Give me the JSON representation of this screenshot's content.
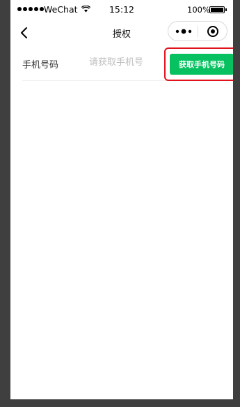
{
  "status_bar": {
    "carrier": "WeChat",
    "time": "15:12",
    "battery": "100%"
  },
  "nav": {
    "title": "授权",
    "icons": {
      "back": "chevron-left-icon",
      "more": "more-dots-icon",
      "close": "target-circle-icon"
    }
  },
  "form": {
    "label": "手机号码",
    "input_placeholder": "请获取手机号",
    "input_value": "",
    "button_label": "获取手机号码"
  },
  "colors": {
    "accent_green": "#07c160",
    "highlight_red": "#e0131c",
    "background_dark": "#3f3f3f"
  }
}
